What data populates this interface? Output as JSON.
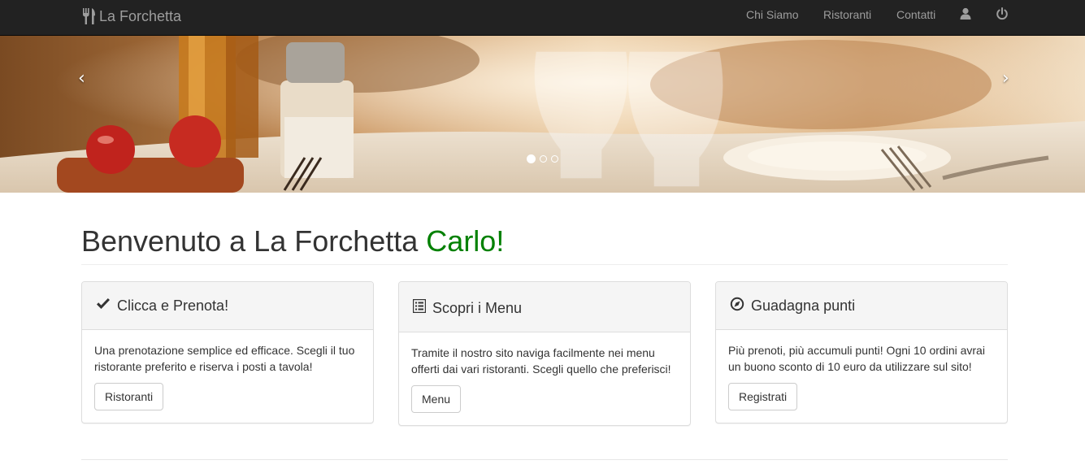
{
  "navbar": {
    "brand": "La Forchetta",
    "links": [
      "Chi Siamo",
      "Ristoranti",
      "Contatti"
    ],
    "user_icon": "user-icon",
    "power_icon": "power-icon"
  },
  "carousel": {
    "prev": "‹",
    "next": "›",
    "slides_count": 3,
    "active_slide": 1
  },
  "welcome": {
    "text": "Benvenuto a La Forchetta ",
    "name": "Carlo!",
    "name_color": "#008000"
  },
  "panels": [
    {
      "icon": "check-icon",
      "title": "Clicca e Prenota!",
      "text": "Una prenotazione semplice ed efficace. Scegli il tuo ristorante preferito e riserva i posti a tavola!",
      "button": "Ristoranti"
    },
    {
      "icon": "list-icon",
      "title": "Scopri i Menu",
      "text": "Tramite il nostro sito naviga facilmente nei menu offerti dai vari ristoranti. Scegli quello che preferisci!",
      "button": "Menu"
    },
    {
      "icon": "compass-icon",
      "title": "Guadagna punti",
      "text": "Più prenoti, più accumuli punti! Ogni 10 ordini avrai un buono sconto di 10 euro da utilizzare sul sito!",
      "button": "Registrati"
    }
  ]
}
